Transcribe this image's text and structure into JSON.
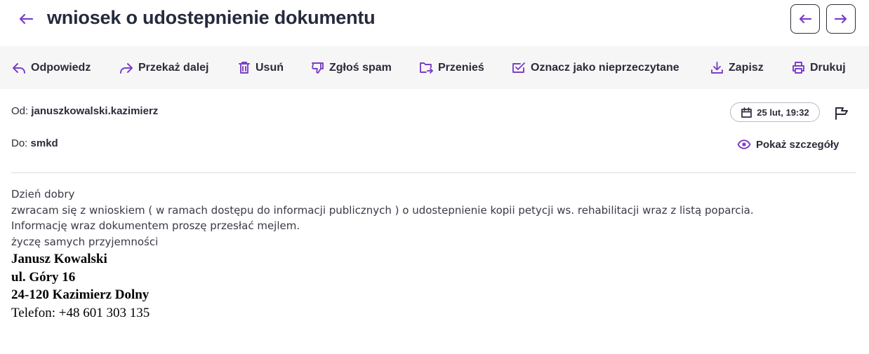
{
  "header": {
    "title": "wniosek o udostepnienie dokumentu"
  },
  "toolbar": {
    "items": [
      {
        "label": "Odpowiedz",
        "icon": "reply-icon"
      },
      {
        "label": "Przekaż dalej",
        "icon": "forward-icon"
      },
      {
        "label": "Usuń",
        "icon": "trash-icon"
      },
      {
        "label": "Zgłoś spam",
        "icon": "thumbs-down-icon"
      },
      {
        "label": "Przenieś",
        "icon": "move-folder-icon"
      },
      {
        "label": "Oznacz jako nieprzeczytane",
        "icon": "mark-unread-icon"
      },
      {
        "label": "Zapisz",
        "icon": "download-icon"
      },
      {
        "label": "Drukuj",
        "icon": "printer-icon"
      }
    ]
  },
  "meta": {
    "from_label": "Od:",
    "from_value": "januszkowalski.kazimierz",
    "to_label": "Do:",
    "to_value": "smkd",
    "date": "25 lut, 19:32",
    "details_label": "Pokaż szczegóły"
  },
  "message": {
    "lines": [
      "Dzień dobry",
      "zwracam się z wnioskiem ( w ramach dostępu do informacji publicznych ) o udostepnienie kopii petycji ws. rehabilitacji wraz z listą poparcia.",
      "Informację wraz dokumentem proszę przesłać mejlem.",
      "życzę samych przyjemności"
    ],
    "signature": {
      "name": "Janusz Kowalski",
      "street": "ul. Góry 16",
      "city": "24-120 Kazimierz Dolny",
      "phone": "Telefon: +48 601 303 135"
    }
  },
  "colors": {
    "accent": "#7b3fc4",
    "toolbar_bg": "#f6f6f7",
    "title": "#252a3d"
  }
}
